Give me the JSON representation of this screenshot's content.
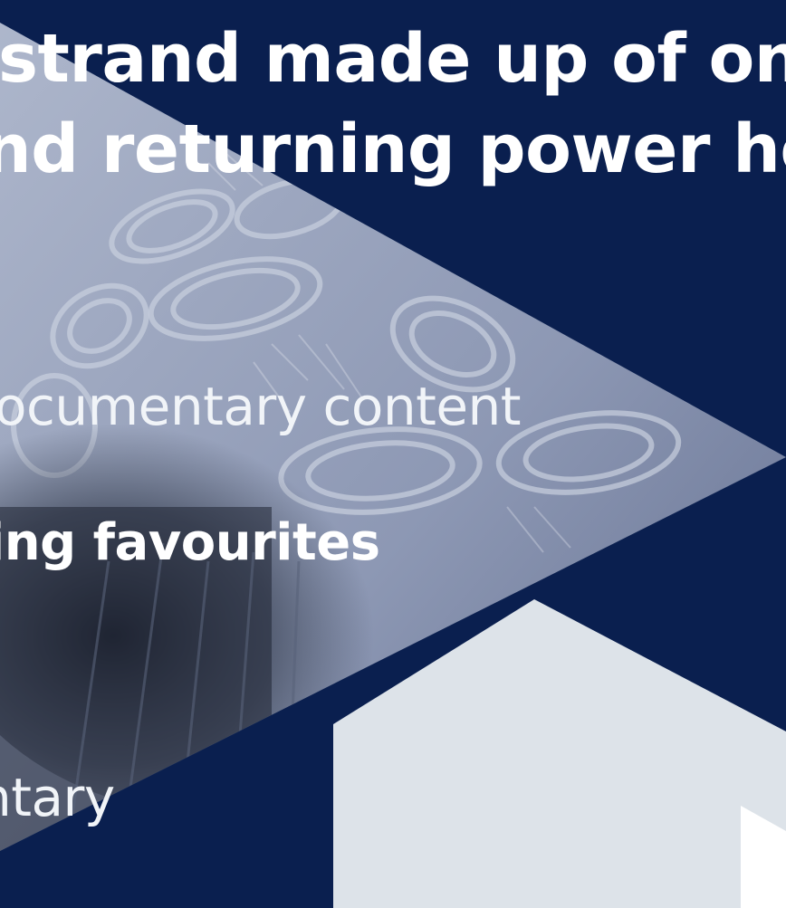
{
  "colors": {
    "navy": "#0a1f4f",
    "pale_panel": "#dde3e9",
    "white": "#ffffff",
    "photo_tint": "#98a4be"
  },
  "headline": {
    "line1": "strand made up of one",
    "line2": "nd returning power ho"
  },
  "items": {
    "line1": "ocumentary content",
    "line2": "ing favourites",
    "line3": "ntary"
  }
}
